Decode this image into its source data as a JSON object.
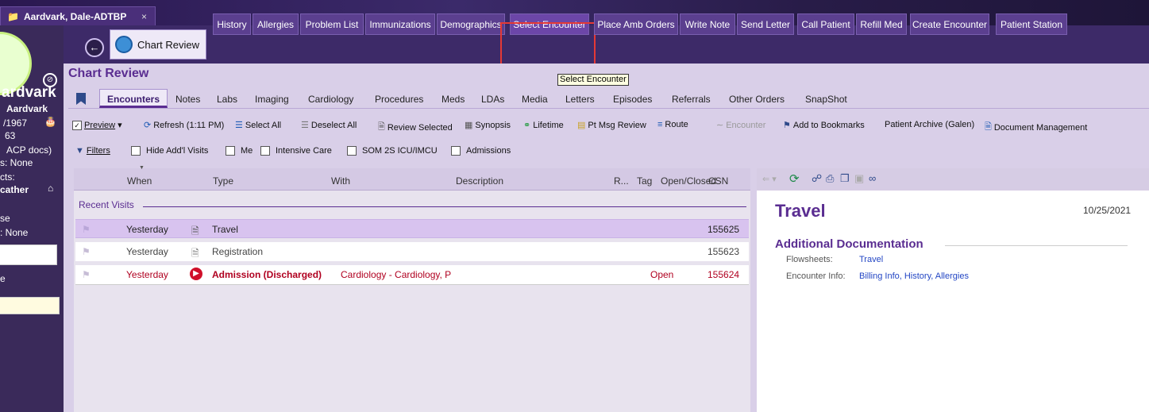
{
  "window_tab": {
    "title": "Aardvark, Dale-ADTBP",
    "close": "×"
  },
  "sidebar": {
    "name": "ardvark",
    "lines": [
      "Aardvark",
      "/1967",
      "63",
      "ACP docs)",
      "s: None",
      "cts:",
      "cather",
      "se",
      ": None",
      "e"
    ]
  },
  "activity_tabs": [
    {
      "label": "Chart Review"
    },
    {
      "label": "History"
    },
    {
      "label": "Allergies"
    },
    {
      "label": "Problem List"
    },
    {
      "label": "Immunizations"
    },
    {
      "label": "Demographics"
    },
    {
      "label": "Select Encounter"
    },
    {
      "label": "Place Amb Orders"
    },
    {
      "label": "Write Note"
    },
    {
      "label": "Send Letter"
    },
    {
      "label": "Call Patient"
    },
    {
      "label": "Refill Med"
    },
    {
      "label": "Create Encounter"
    },
    {
      "label": "Patient Station"
    }
  ],
  "tooltip": "Select Encounter",
  "section_title": "Chart Review",
  "subtabs": [
    "Encounters",
    "Notes",
    "Labs",
    "Imaging",
    "Cardiology",
    "Procedures",
    "Meds",
    "LDAs",
    "Media",
    "Letters",
    "Episodes",
    "Referrals",
    "Other Orders",
    "SnapShot"
  ],
  "toolbar1": {
    "preview": "Preview",
    "refresh": "Refresh (1:11 PM)",
    "select_all": "Select All",
    "deselect_all": "Deselect All",
    "review_selected": "Review Selected",
    "synopsis": "Synopsis",
    "lifetime": "Lifetime",
    "pt_msg_review": "Pt Msg Review",
    "route": "Route",
    "encounter": "Encounter",
    "add_bookmarks": "Add to Bookmarks",
    "patient_archive": "Patient Archive (Galen)",
    "doc_mgmt": "Document Management"
  },
  "toolbar2": {
    "filters": "Filters",
    "hide_visits": "Hide Add'l Visits",
    "me": "Me",
    "icu": "Intensive Care",
    "som": "SOM 2S ICU/IMCU",
    "admissions": "Admissions"
  },
  "grid": {
    "headers": {
      "when": "When",
      "type": "Type",
      "with": "With",
      "description": "Description",
      "r": "R...",
      "tag": "Tag",
      "open_closed": "Open/Closed",
      "csn": "CSN"
    },
    "group": "Recent Visits",
    "rows": [
      {
        "when": "Yesterday",
        "type": "Travel",
        "status": "",
        "csn": "155625"
      },
      {
        "when": "Yesterday",
        "type": "Registration",
        "status": "",
        "csn": "155623"
      },
      {
        "when": "Yesterday",
        "type": "Admission (Discharged)",
        "with": "Cardiology - Cardiology, P",
        "status": "Open",
        "csn": "155624"
      }
    ]
  },
  "detail": {
    "title": "Travel",
    "date": "10/25/2021",
    "section": "Additional Documentation",
    "flowsheets_label": "Flowsheets:",
    "flowsheets_link": "Travel",
    "encounter_label": "Encounter Info:",
    "encounter_links": "Billing Info, History, Allergies"
  },
  "colors": {
    "accent": "#6b2fa0",
    "highlight": "#e53935",
    "admission_red": "#b00020"
  }
}
